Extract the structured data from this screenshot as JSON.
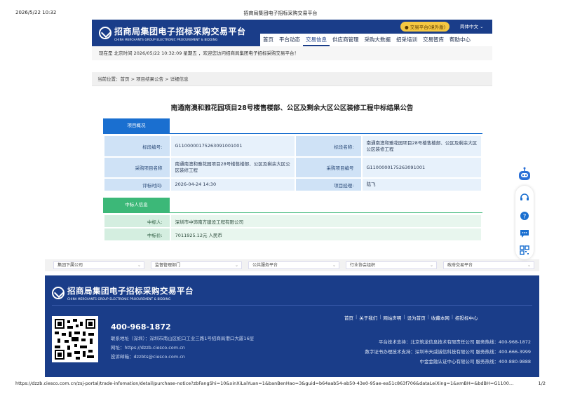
{
  "print": {
    "datetime": "2026/5/22 10:32",
    "title": "招商局集团电子招标采购交易平台",
    "url": "https://dzzb.ciesco.com.cn/zsj-portal/trade-infomation/detail/purchase-notice?zbFangShi=10&xinXiLaiYuan=1&banBenHao=3&guid=b64aab54-ab50-43e0-95ae-ea51c863f706&dataLeiXing=1&xmBH=&bdBH=G1100…",
    "page": "1/2"
  },
  "header": {
    "logo_cn": "招商局集团电子招标采购交易平台",
    "logo_en": "CHINA MERCHANTS GROUP ELECTRONIC PROCUREMENT & BIDDING",
    "overseas": "交易平台(境外版)",
    "language": "简体中文",
    "nav": [
      "首页",
      "平台动态",
      "交易信息",
      "供应商管理",
      "采购大数据",
      "招采培训",
      "交易智库",
      "帮助中心"
    ],
    "active_nav": "交易信息"
  },
  "welcome": "现在是 北京时间 2026/05/22 10:32:09 星期五 ，欢迎您访问招商局集团电子招标采购交易平台！",
  "breadcrumb": "当前位置：首页 > 项目结果公告 > 详细信息",
  "notice": {
    "title": "南通南澳和雅花园项目28号楼售楼部、公区及剩余大区公区装修工程中标结果公告",
    "project_section": {
      "heading": "项目概况",
      "rows": [
        {
          "l1": "标段编号:",
          "v1": "G1100000175263091001001",
          "l2": "标段名称:",
          "v2": "南通南澳和雅花园项目28号楼售楼部、公区及剩余大区公区装修工程"
        },
        {
          "l1": "采购项目名称",
          "v1": "南通南澳和雅花园项目28号楼售楼部、公区及剩余大区公区装修工程",
          "l2": "采购项目编号",
          "v2": "G1100000175263091001"
        },
        {
          "l1": "评标时间:",
          "v1": "2026-04-24 14:30",
          "l2": "项目经理:",
          "v2": "陆飞"
        }
      ]
    },
    "winner_section": {
      "heading": "中标人信息",
      "rows": [
        {
          "label": "中标人:",
          "value": "深圳市中饰南方建设工程有限公司"
        },
        {
          "label": "中标价:",
          "value": "7011925.12元 人民币"
        }
      ]
    }
  },
  "filters": [
    "集团下属公司",
    "监督管理部门",
    "公共服务平台",
    "行业协会组织",
    "政府交易平台"
  ],
  "footer": {
    "logo_cn": "招商局集团电子招标采购交易平台",
    "logo_en": "CHINA MERCHANTS GROUP ELECTRONIC PROCUREMENT & BIDDING",
    "phone": "400-968-1872",
    "address": "联系地址（深圳）：深圳市南山区蛇口工业三路1号招商局港口大厦16层",
    "website": "网址：https://dzzb.ciesco.com.cn",
    "email": "投诉邮箱：dzzbts@ciesco.com.cn",
    "links": [
      "首页",
      "关于我们",
      "网站声明",
      "设为首页",
      "收藏本网",
      "招投标中心"
    ],
    "support": [
      "平台技术支持：北京筑龙信息技术有限责任公司 服务热线：400-968-1872",
      "数字证书办理技术支持：深圳市天威诚信科技有限公司 服务热线：400-666-3999",
      "中金金融认证中心有限公司 服务热线：400-880-9888"
    ]
  },
  "colors": {
    "brand_blue": "#1a3d89",
    "section_blue": "#1a6fd0",
    "section_green": "#3cb878",
    "pill": "#f5c842"
  }
}
